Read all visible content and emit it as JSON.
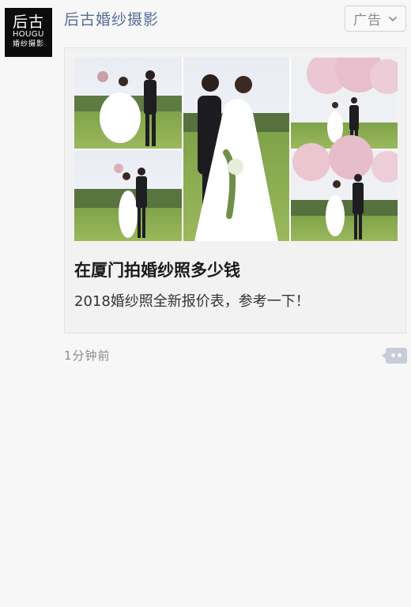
{
  "advertiser": {
    "logo_main": "后古",
    "logo_en": "HOUGU",
    "logo_sub": "婚纱摄影",
    "name": "后古婚纱摄影"
  },
  "ad_badge": {
    "label": "广告",
    "icon": "chevron-down-icon"
  },
  "card": {
    "image": "wedding-photo-collage",
    "title": "在厦门拍婚纱照多少钱",
    "description": "2018婚纱照全新报价表，参考一下！"
  },
  "post": {
    "timestamp": "1分钟前",
    "more_icon": "more-comment-icon"
  },
  "colors": {
    "link_blue": "#576b95",
    "background": "#f7f7f7",
    "card_background": "#f2f2f2",
    "more_button": "#c7ccd8"
  }
}
